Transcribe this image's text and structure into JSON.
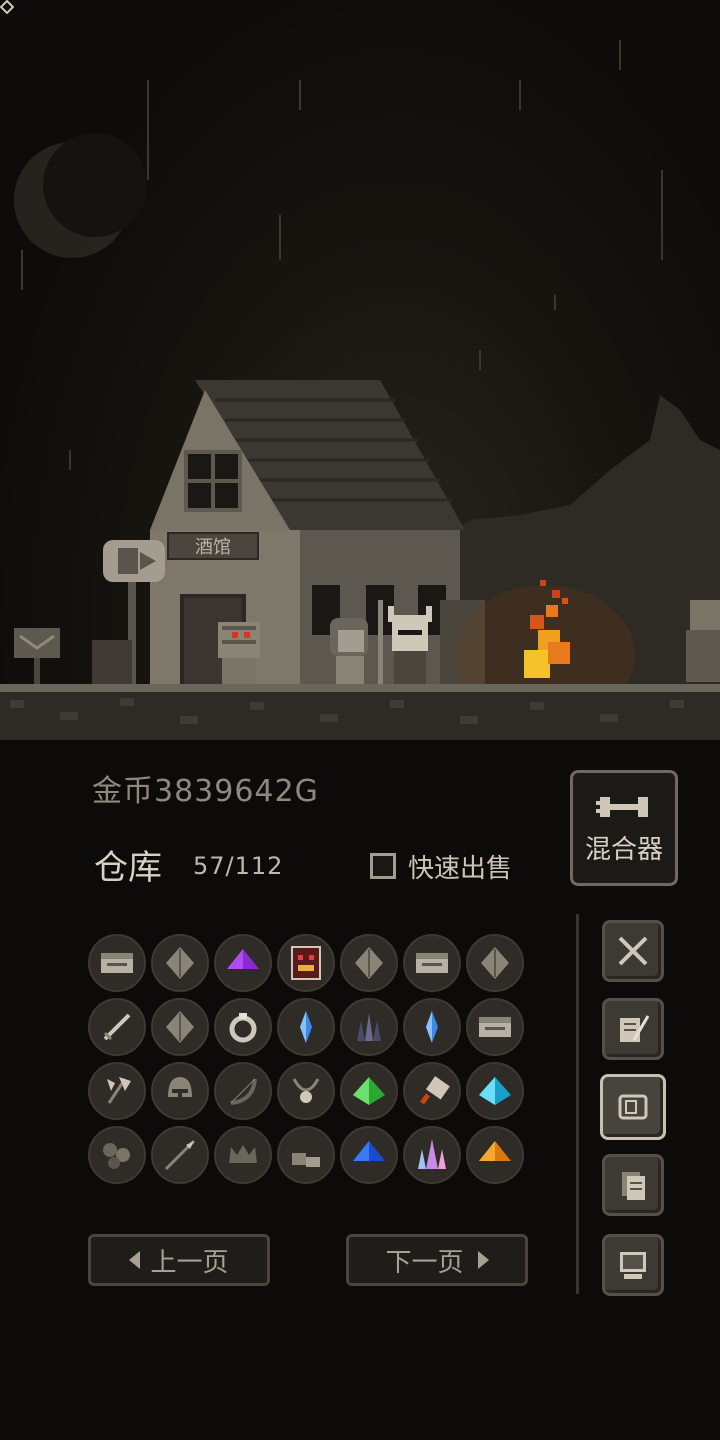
{
  "scene": {
    "tavern_sign": "酒馆"
  },
  "status": {
    "gold_label": "金币3839642G"
  },
  "storage": {
    "title": "仓库",
    "count": "57/112",
    "quick_sell_label": "快速出售",
    "quick_sell_checked": false
  },
  "mixer": {
    "label": "混合器"
  },
  "inventory": {
    "rows": [
      [
        "scroll-chest-icon",
        "leaf-seed-icon",
        "purple-gem-icon",
        "monster-card-icon",
        "leaf-seed-icon",
        "scroll-chest-icon",
        "leaf-seed-icon"
      ],
      [
        "sword-icon",
        "leaf-seed-icon",
        "ring-icon",
        "blue-crystal-icon",
        "dark-crystal-icon",
        "blue-crystal-icon",
        "scroll-chest-icon"
      ],
      [
        "axe-icon",
        "helmet-icon",
        "bow-icon",
        "necklace-icon",
        "green-gem-icon",
        "cleaver-icon",
        "cyan-gem-icon"
      ],
      [
        "stones-icon",
        "spear-icon",
        "crown-icon",
        "boots-icon",
        "blue-gem-icon",
        "pink-crystal-icon",
        "orange-gem-icon"
      ]
    ]
  },
  "pagination": {
    "prev_label": "上一页",
    "next_label": "下一页"
  },
  "side_tabs": [
    {
      "name": "crossed-swords-icon",
      "active": false
    },
    {
      "name": "quill-scroll-icon",
      "active": false
    },
    {
      "name": "map-scroll-icon",
      "active": true
    },
    {
      "name": "documents-icon",
      "active": false
    },
    {
      "name": "computer-icon",
      "active": false
    }
  ],
  "colors": {
    "background": "#0c0b09",
    "panel_border": "#6f695f",
    "text_primary": "#d8d0c2",
    "text_muted": "#8f887d",
    "fire": "#e87a1c"
  }
}
